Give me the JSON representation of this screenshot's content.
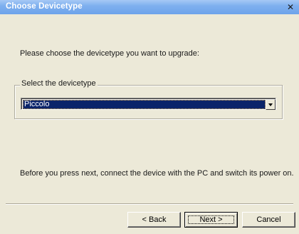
{
  "window": {
    "title": "Choose Devicetype",
    "close_glyph": "✕"
  },
  "content": {
    "instruction": "Please choose the devicetype you want to upgrade:",
    "group_label": "Select the devicetype",
    "selected_device": "Piccolo",
    "note": "Before you press next, connect the device with the PC and switch its power on."
  },
  "buttons": {
    "back_label": "< Back",
    "next_label": "Next >",
    "cancel_label": "Cancel"
  },
  "colors": {
    "titlebar": "#7fb0ef",
    "selection": "#0a246a",
    "dialog_bg": "#ece9d8"
  }
}
